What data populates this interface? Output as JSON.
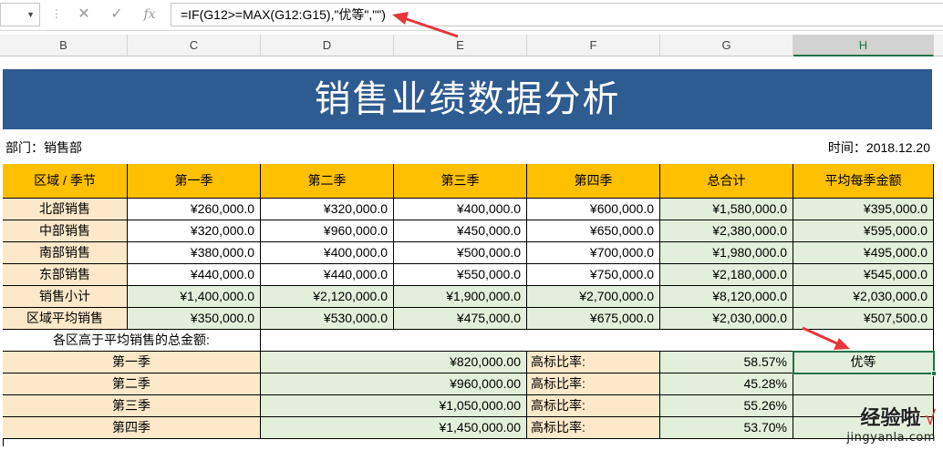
{
  "formula_bar": {
    "formula": "=IF(G12>=MAX(G12:G15),\"优等\",\"\")",
    "cancel_icon": "close-icon",
    "confirm_icon": "check-icon",
    "function_icon": "fx-icon",
    "fx_label": "fx"
  },
  "columns": [
    "B",
    "C",
    "D",
    "E",
    "F",
    "G",
    "H"
  ],
  "selected_column": "H",
  "sheet": {
    "title": "销售业绩数据分析",
    "department": "部门：销售部",
    "time": "时间：2018.12.20",
    "header": [
      "区域 / 季节",
      "第一季",
      "第二季",
      "第三季",
      "第四季",
      "总合计",
      "平均每季金额"
    ],
    "rows": [
      [
        "北部销售",
        "¥260,000.0",
        "¥320,000.0",
        "¥400,000.0",
        "¥600,000.0",
        "¥1,580,000.0",
        "¥395,000.0"
      ],
      [
        "中部销售",
        "¥320,000.0",
        "¥960,000.0",
        "¥450,000.0",
        "¥650,000.0",
        "¥2,380,000.0",
        "¥595,000.0"
      ],
      [
        "南部销售",
        "¥380,000.0",
        "¥400,000.0",
        "¥500,000.0",
        "¥700,000.0",
        "¥1,980,000.0",
        "¥495,000.0"
      ],
      [
        "东部销售",
        "¥440,000.0",
        "¥440,000.0",
        "¥550,000.0",
        "¥750,000.0",
        "¥2,180,000.0",
        "¥545,000.0"
      ],
      [
        "销售小计",
        "¥1,400,000.0",
        "¥2,120,000.0",
        "¥1,900,000.0",
        "¥2,700,000.0",
        "¥8,120,000.0",
        "¥2,030,000.0"
      ],
      [
        "区域平均销售",
        "¥350,000.0",
        "¥530,000.0",
        "¥475,000.0",
        "¥675,000.0",
        "¥2,030,000.0",
        "¥507,500.0"
      ]
    ],
    "above_avg_label": "各区高于平均销售的总金额:",
    "quarters": [
      {
        "season": "第一季",
        "amount": "¥820,000.00",
        "ratio_label": "高标比率:",
        "ratio": "58.57%",
        "grade": "优等"
      },
      {
        "season": "第二季",
        "amount": "¥960,000.00",
        "ratio_label": "高标比率:",
        "ratio": "45.28%",
        "grade": ""
      },
      {
        "season": "第三季",
        "amount": "¥1,050,000.00",
        "ratio_label": "高标比率:",
        "ratio": "55.26%",
        "grade": ""
      },
      {
        "season": "第四季",
        "amount": "¥1,450,000.00",
        "ratio_label": "高标比率:",
        "ratio": "53.70%",
        "grade": ""
      }
    ]
  },
  "watermark": {
    "text": "经验啦",
    "check": "√",
    "url": "jingyanla.com"
  },
  "colors": {
    "title_band": "#2e5b90",
    "header_fill": "#ffc000",
    "label_fill": "#fde9c9",
    "value_fill": "#e2efda",
    "annotation_arrow": "#e8363a",
    "selection": "#217346"
  }
}
